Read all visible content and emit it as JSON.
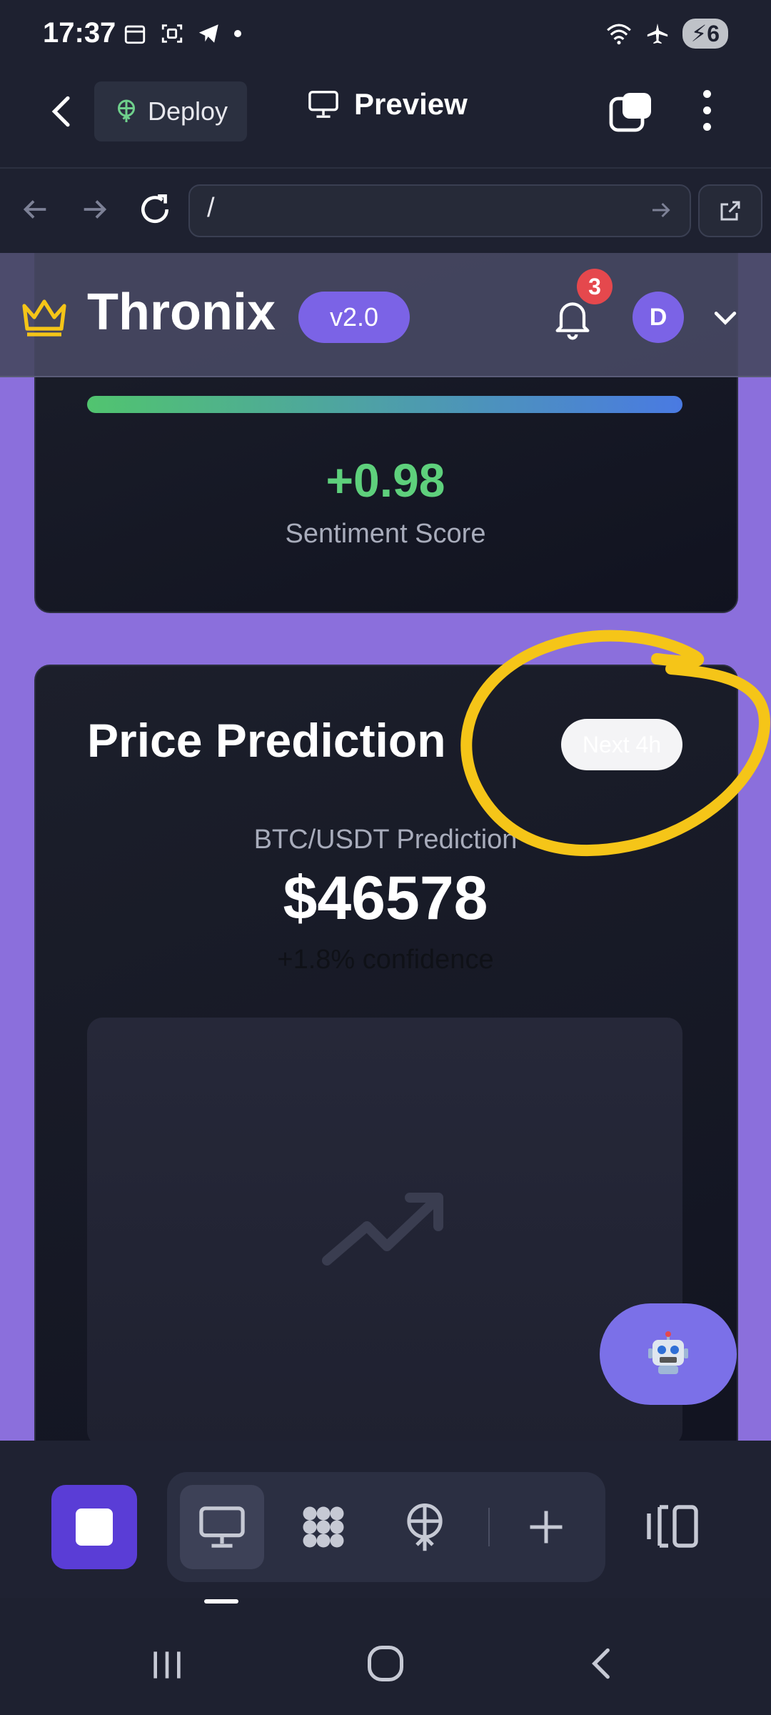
{
  "status": {
    "time": "17:37",
    "battery": "6"
  },
  "toolbar": {
    "deploy_label": "Deploy",
    "preview_label": "Preview"
  },
  "browser": {
    "url": "/"
  },
  "app_header": {
    "brand": "Thronix",
    "version": "v2.0",
    "notification_count": "3",
    "avatar_initial": "D"
  },
  "sentiment_card": {
    "score": "+0.98",
    "label": "Sentiment Score",
    "bar_fill_percent": 98
  },
  "prediction_card": {
    "title": "Price Prediction",
    "timeframe": "Next 4h",
    "pair_label": "BTC/USDT Prediction",
    "price": "$46578",
    "confidence": "+1.8% confidence"
  },
  "colors": {
    "accent": "#7b63e6",
    "positive": "#5ed07c",
    "page_bg": "#8b6fdc",
    "annotation": "#f5c518"
  },
  "icons": {
    "fab": "robot-icon",
    "chart_placeholder": "trending-up-icon"
  }
}
